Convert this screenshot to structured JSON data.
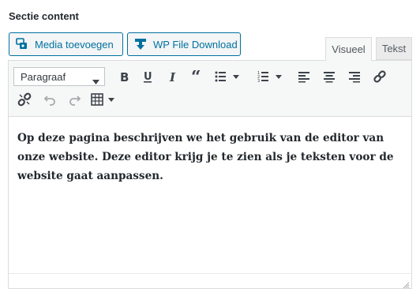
{
  "section": {
    "title": "Sectie content"
  },
  "buttons": {
    "media": {
      "label": "Media toevoegen",
      "icon": "media-add-icon"
    },
    "wp_file_download": {
      "label": "WP File Download",
      "icon": "download-icon"
    }
  },
  "tabs": {
    "visual": {
      "label": "Visueel",
      "active": true
    },
    "text": {
      "label": "Tekst",
      "active": false
    }
  },
  "toolbar": {
    "format_select": {
      "value": "Paragraaf"
    },
    "row1_icons": [
      "bold-icon",
      "underline-icon",
      "italic-icon",
      "blockquote-icon",
      "bullet-list-icon",
      "numbered-list-icon",
      "align-left-icon",
      "align-center-icon",
      "align-right-icon",
      "link-icon"
    ],
    "row2_icons": [
      "unlink-icon",
      "undo-icon",
      "redo-icon",
      "table-icon"
    ]
  },
  "editor": {
    "content": "Op deze pagina beschrijven we het gebruik van de editor van onze website. Deze editor krijg je te zien als je teksten voor de website gaat aanpassen."
  },
  "colors": {
    "accent": "#0071a1",
    "toolbar_bg": "#f6f7f7",
    "border": "#dcdcde",
    "icon": "#3c434a"
  }
}
